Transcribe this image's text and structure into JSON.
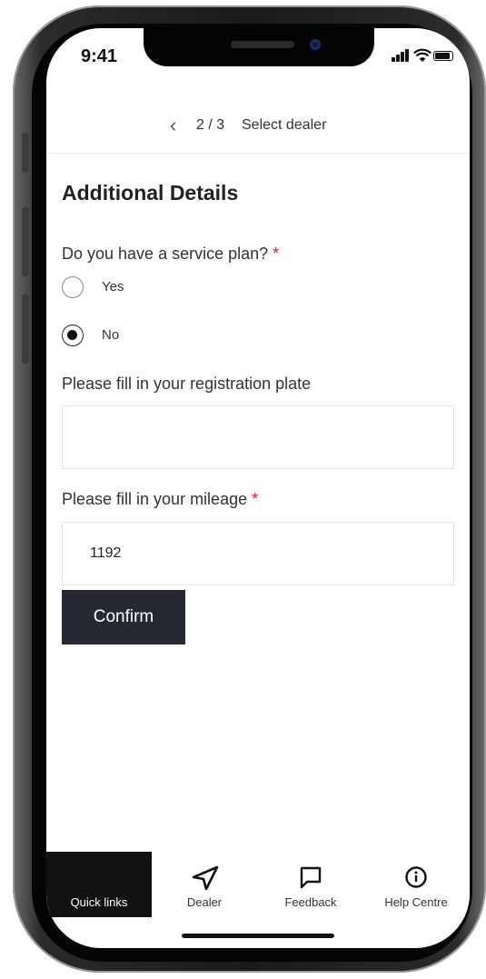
{
  "status_bar": {
    "time": "9:41"
  },
  "header": {
    "step": "2 / 3",
    "label": "Select dealer",
    "back_icon": "chevron-left-icon"
  },
  "form": {
    "title": "Additional Details",
    "service_plan": {
      "question": "Do you have a service plan?",
      "required_mark": "*",
      "options": [
        {
          "label": "Yes",
          "selected": false
        },
        {
          "label": "No",
          "selected": true
        }
      ]
    },
    "registration": {
      "label": "Please fill in your registration plate",
      "value": ""
    },
    "mileage": {
      "label": "Please fill in your mileage",
      "required_mark": "*",
      "value": "1192"
    },
    "confirm_label": "Confirm"
  },
  "tabbar": {
    "items": [
      {
        "label": "Quick links",
        "icon": "list-icon",
        "active": true
      },
      {
        "label": "Dealer",
        "icon": "navigation-arrow-icon",
        "active": false
      },
      {
        "label": "Feedback",
        "icon": "chat-bubble-icon",
        "active": false
      },
      {
        "label": "Help Centre",
        "icon": "info-icon",
        "active": false
      }
    ]
  },
  "colors": {
    "accent_dark": "#262832",
    "required": "#d4202a",
    "active_tab": "#111111"
  }
}
